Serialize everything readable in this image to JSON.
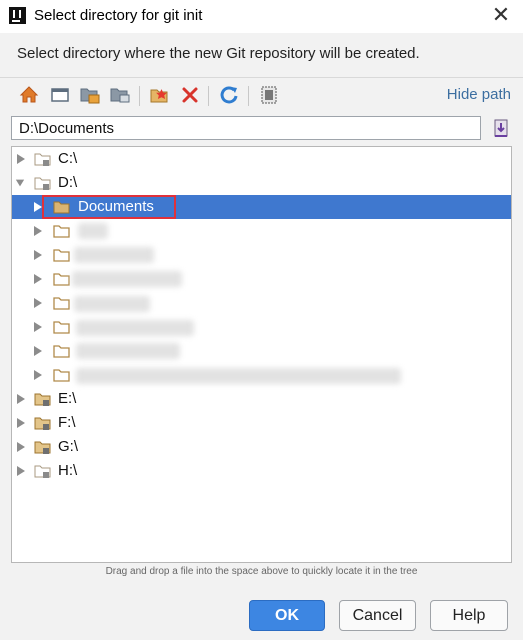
{
  "window": {
    "title": "Select directory for git init",
    "description": "Select directory where the new Git repository will be created."
  },
  "toolbar": {
    "icons": [
      "home-icon",
      "desktop-icon",
      "project-folder-icon",
      "module-folder-icon",
      "new-folder-icon",
      "delete-icon",
      "refresh-icon",
      "show-hidden-icon"
    ],
    "hide_path_label": "Hide path"
  },
  "path_field": {
    "value": "D:\\Documents"
  },
  "tree": {
    "drives": [
      {
        "label": "C:\\",
        "expanded": false
      },
      {
        "label": "D:\\",
        "expanded": true
      },
      {
        "label": "E:\\",
        "expanded": false
      },
      {
        "label": "F:\\",
        "expanded": false
      },
      {
        "label": "G:\\",
        "expanded": false
      },
      {
        "label": "H:\\",
        "expanded": false
      }
    ],
    "selected_folder": "Documents",
    "obscured_children": 7
  },
  "hint": "Drag and drop a file into the space above to quickly locate it in the tree",
  "buttons": {
    "ok": "OK",
    "cancel": "Cancel",
    "help": "Help"
  },
  "colors": {
    "selection": "#3f78cf",
    "primary_button": "#3d86e2",
    "highlight_box": "#e0313a",
    "folder": "#c9a15b",
    "link": "#3c6ea0"
  }
}
